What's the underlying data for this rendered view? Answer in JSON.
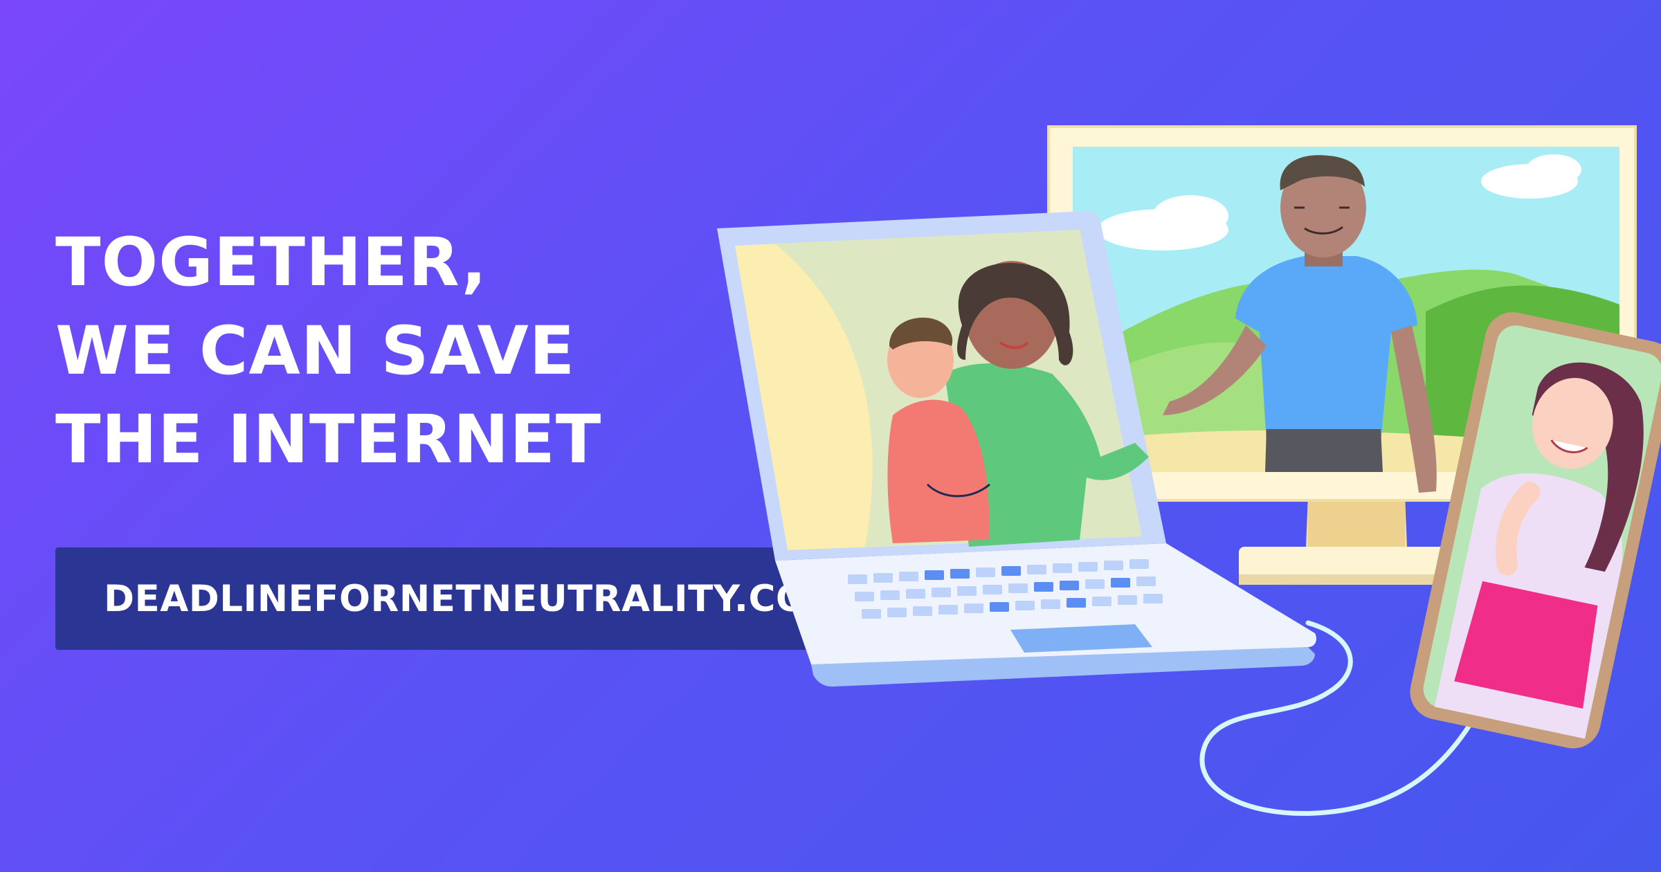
{
  "headline": {
    "line1": "TOGETHER,",
    "line2": "WE CAN SAVE",
    "line3": "THE INTERNET"
  },
  "url": "DEADLINEFORNETNEUTRALITY.COM",
  "colors": {
    "background_start": "#7a47fa",
    "background_end": "#4657ee",
    "url_bar": "#2b3594",
    "text": "#ffffff"
  },
  "illustration": {
    "icons": [
      "laptop-icon",
      "monitor-icon",
      "smartphone-icon",
      "cable-icon"
    ]
  }
}
